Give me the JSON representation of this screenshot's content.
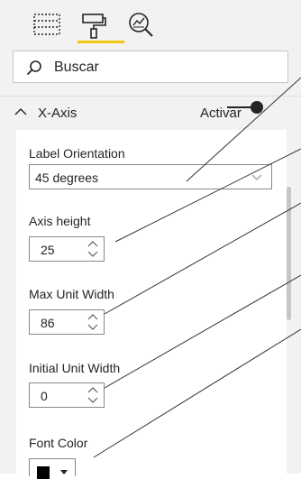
{
  "tabs": [
    {
      "icon": "fields-icon",
      "active": false
    },
    {
      "icon": "format-paint-roller-icon",
      "active": true
    },
    {
      "icon": "analytics-magnifier-icon",
      "active": false
    }
  ],
  "search": {
    "placeholder": "Buscar"
  },
  "section": {
    "title": "X-Axis",
    "toggle_label": "Activar",
    "toggle_on": true
  },
  "fields": {
    "label_orientation": {
      "label": "Label Orientation",
      "value": "45 degrees"
    },
    "axis_height": {
      "label": "Axis height",
      "value": "25"
    },
    "max_unit_width": {
      "label": "Max Unit Width",
      "value": "86"
    },
    "initial_unit_width": {
      "label": "Initial Unit Width",
      "value": "0"
    },
    "font_color": {
      "label": "Font Color",
      "value": "#000000"
    }
  },
  "colors": {
    "accent": "#f2c811",
    "panel_bg": "#f3f2f1",
    "inner_bg": "#ffffff"
  }
}
